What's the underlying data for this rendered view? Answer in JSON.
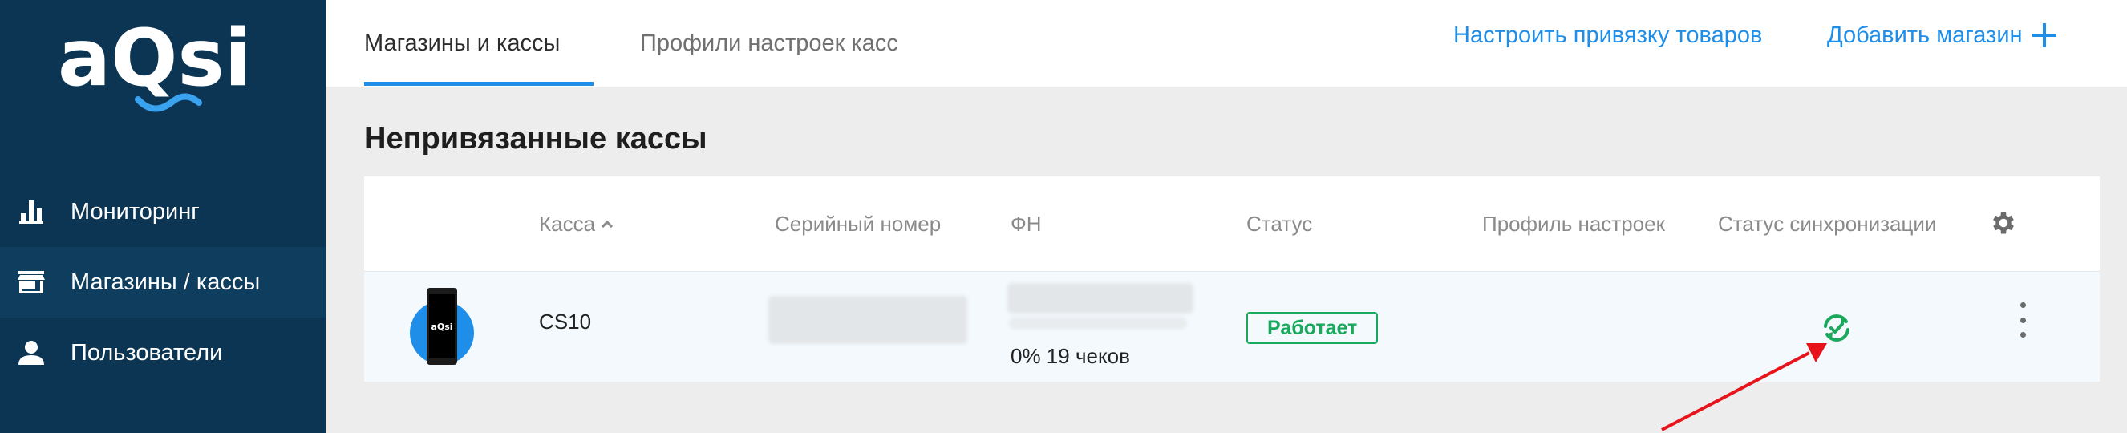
{
  "brand": {
    "logo_text": "aQsi"
  },
  "sidebar": {
    "items": [
      {
        "label": "Мониторинг",
        "icon": "bar-chart-icon"
      },
      {
        "label": "Магазины / кассы",
        "icon": "store-icon",
        "active": true
      },
      {
        "label": "Пользователи",
        "icon": "user-icon"
      }
    ]
  },
  "header": {
    "tabs": [
      {
        "label": "Магазины и кассы",
        "active": true
      },
      {
        "label": "Профили настроек касс"
      }
    ],
    "link_bind_products": "Настроить привязку товаров",
    "link_add_store": "Добавить магазин"
  },
  "section": {
    "title": "Непривязанные кассы"
  },
  "table": {
    "columns": {
      "kassa": "Касса",
      "serial": "Серийный номер",
      "fn": "ФН",
      "status": "Статус",
      "profile": "Профиль настроек",
      "sync_status": "Статус синхронизации"
    },
    "rows": [
      {
        "name": "CS10",
        "device_screen_text": "aQsi",
        "fn_text": "0% 19 чеков",
        "status": "Работает"
      }
    ]
  },
  "colors": {
    "sidebar_bg": "#0c3553",
    "accent": "#1f8ee8",
    "status_green": "#1aa95c",
    "annotation_red": "#e8141b"
  }
}
